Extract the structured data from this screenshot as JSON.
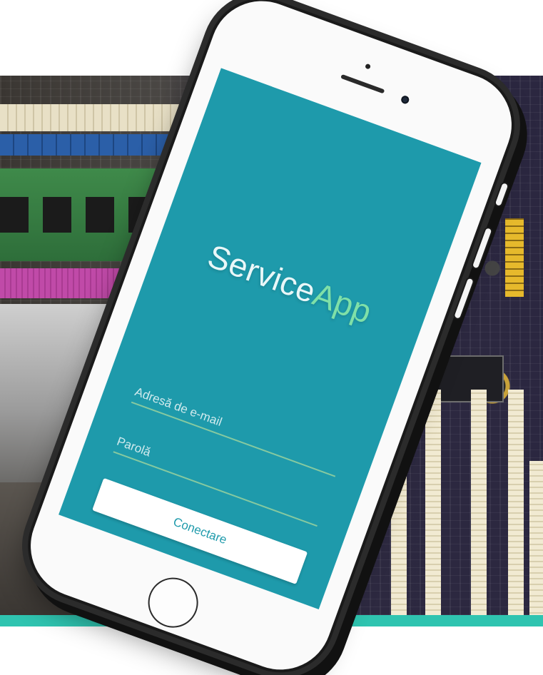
{
  "app": {
    "logo_part_1": "Service",
    "logo_part_2": "App"
  },
  "login": {
    "email_placeholder": "Adresă de e-mail",
    "password_placeholder": "Parolă",
    "connect_label": "Conectare"
  },
  "colors": {
    "screen_background": "#1e9aab",
    "logo_primary": "#e9f7f8",
    "logo_accent": "#7fe0a8",
    "field_underline": "#86c9a0",
    "band": "#2fc4b0"
  },
  "icons": {
    "home_button": "home-button-icon",
    "camera": "front-camera-icon",
    "speaker": "earpiece-speaker-icon"
  }
}
